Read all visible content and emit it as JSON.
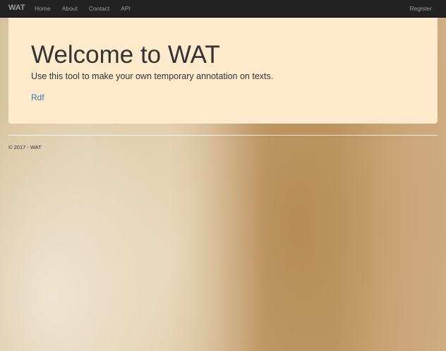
{
  "navbar": {
    "brand": "WAT",
    "links": [
      {
        "label": "Home"
      },
      {
        "label": "About"
      },
      {
        "label": "Contact"
      },
      {
        "label": "API"
      }
    ],
    "register_label": "Register"
  },
  "jumbotron": {
    "title": "Welcome to WAT",
    "lead": "Use this tool to make your own temporary annotation on texts.",
    "link_label": "Rdf"
  },
  "footer": {
    "text": "© 2017 - WAT"
  },
  "colors": {
    "navbar_bg": "#222222",
    "nav_text": "#9d9d9d",
    "jumbotron_bg": "#ffebcc",
    "link": "#337ab7",
    "text": "#333333"
  }
}
